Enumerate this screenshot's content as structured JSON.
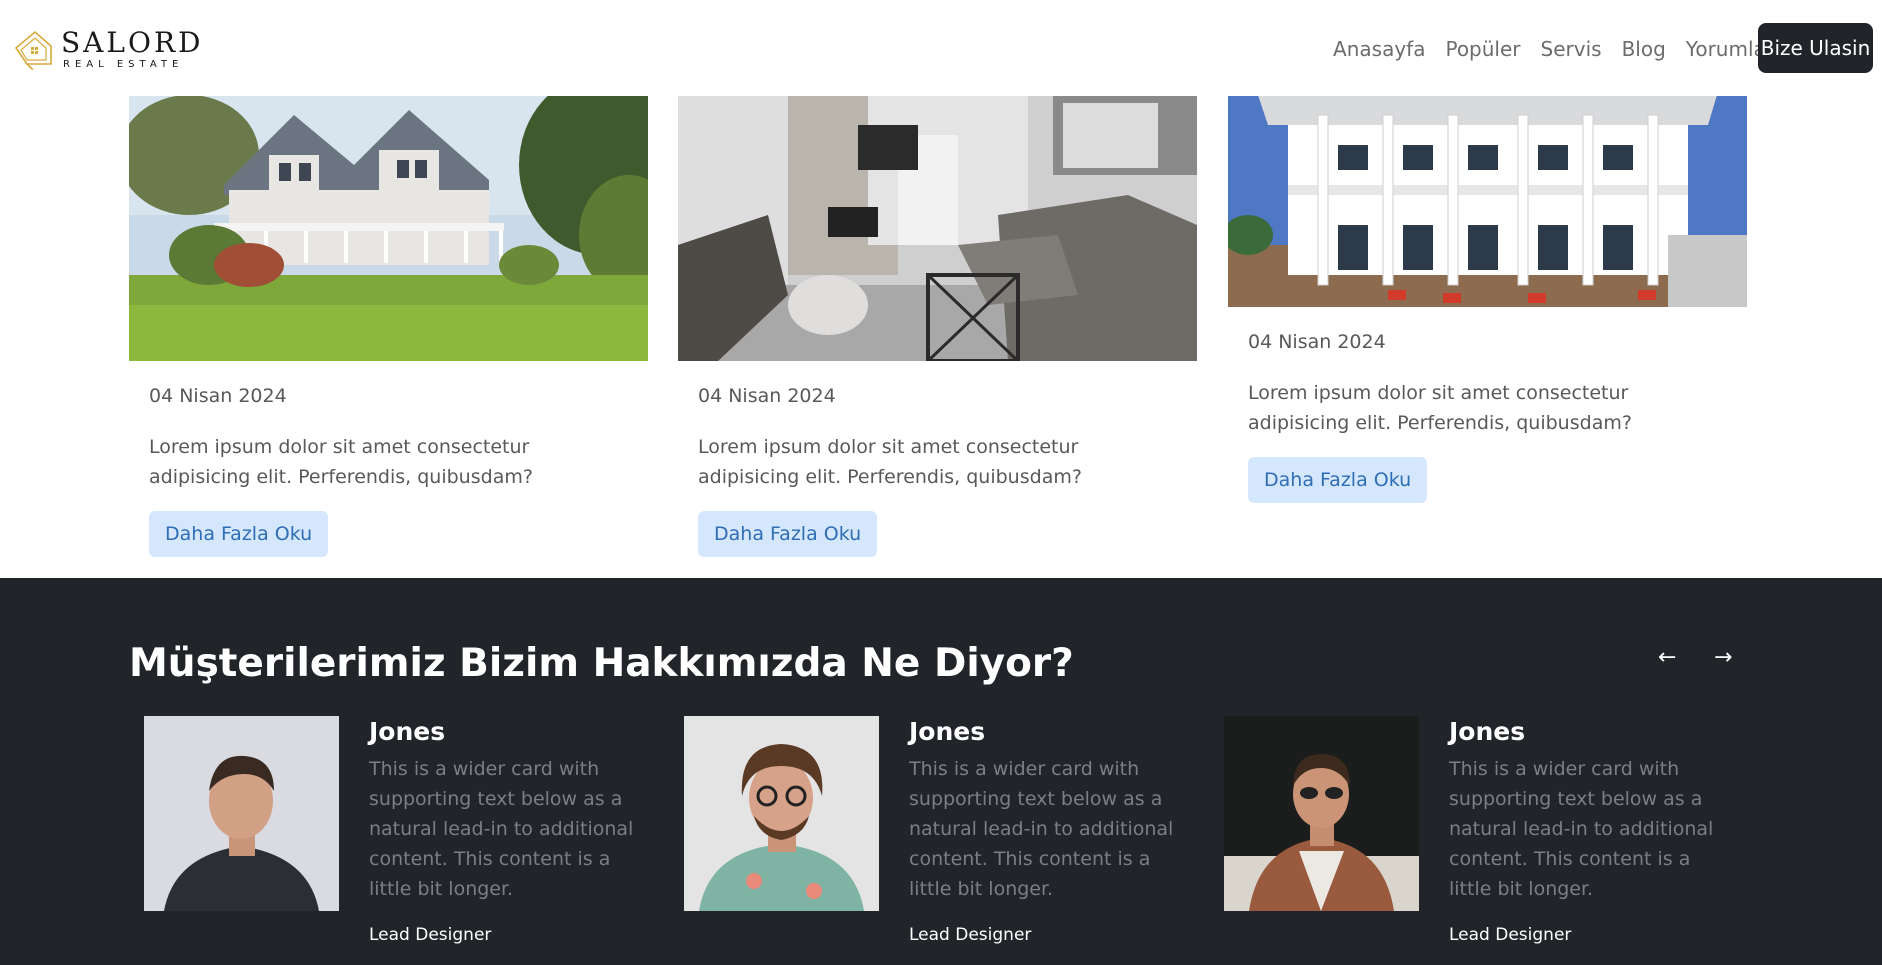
{
  "brand": {
    "name": "SALORD",
    "tagline": "REAL ESTATE"
  },
  "nav": {
    "links": [
      "Anasayfa",
      "Popüler",
      "Servis",
      "Blog",
      "Yorumlar"
    ],
    "cta": "Bize Ulasin"
  },
  "blog": {
    "cards": [
      {
        "date": "04 Nisan 2024",
        "text": "Lorem ipsum dolor sit amet consectetur adipisicing elit. Perferendis, quibusdam?",
        "button": "Daha Fazla Oku"
      },
      {
        "date": "04 Nisan 2024",
        "text": "Lorem ipsum dolor sit amet consectetur adipisicing elit. Perferendis, quibusdam?",
        "button": "Daha Fazla Oku"
      },
      {
        "date": "04 Nisan 2024",
        "text": "Lorem ipsum dolor sit amet consectetur adipisicing elit. Perferendis, quibusdam?",
        "button": "Daha Fazla Oku"
      }
    ]
  },
  "testimonials": {
    "title": "Müşterilerimiz Bizim Hakkımızda Ne Diyor?",
    "prev": "←",
    "next": "→",
    "items": [
      {
        "name": "Jones",
        "text": "This is a wider card with supporting text below as a natural lead-in to additional content. This content is a little bit longer.",
        "role": "Lead Designer"
      },
      {
        "name": "Jones",
        "text": "This is a wider card with supporting text below as a natural lead-in to additional content. This content is a little bit longer.",
        "role": "Lead Designer"
      },
      {
        "name": "Jones",
        "text": "This is a wider card with supporting text below as a natural lead-in to additional content. This content is a little bit longer.",
        "role": "Lead Designer"
      }
    ]
  },
  "colors": {
    "dark": "#212529",
    "button_bg": "#d5e7fd",
    "button_text": "#2f6db5",
    "brand_gold": "#d9a93c"
  }
}
